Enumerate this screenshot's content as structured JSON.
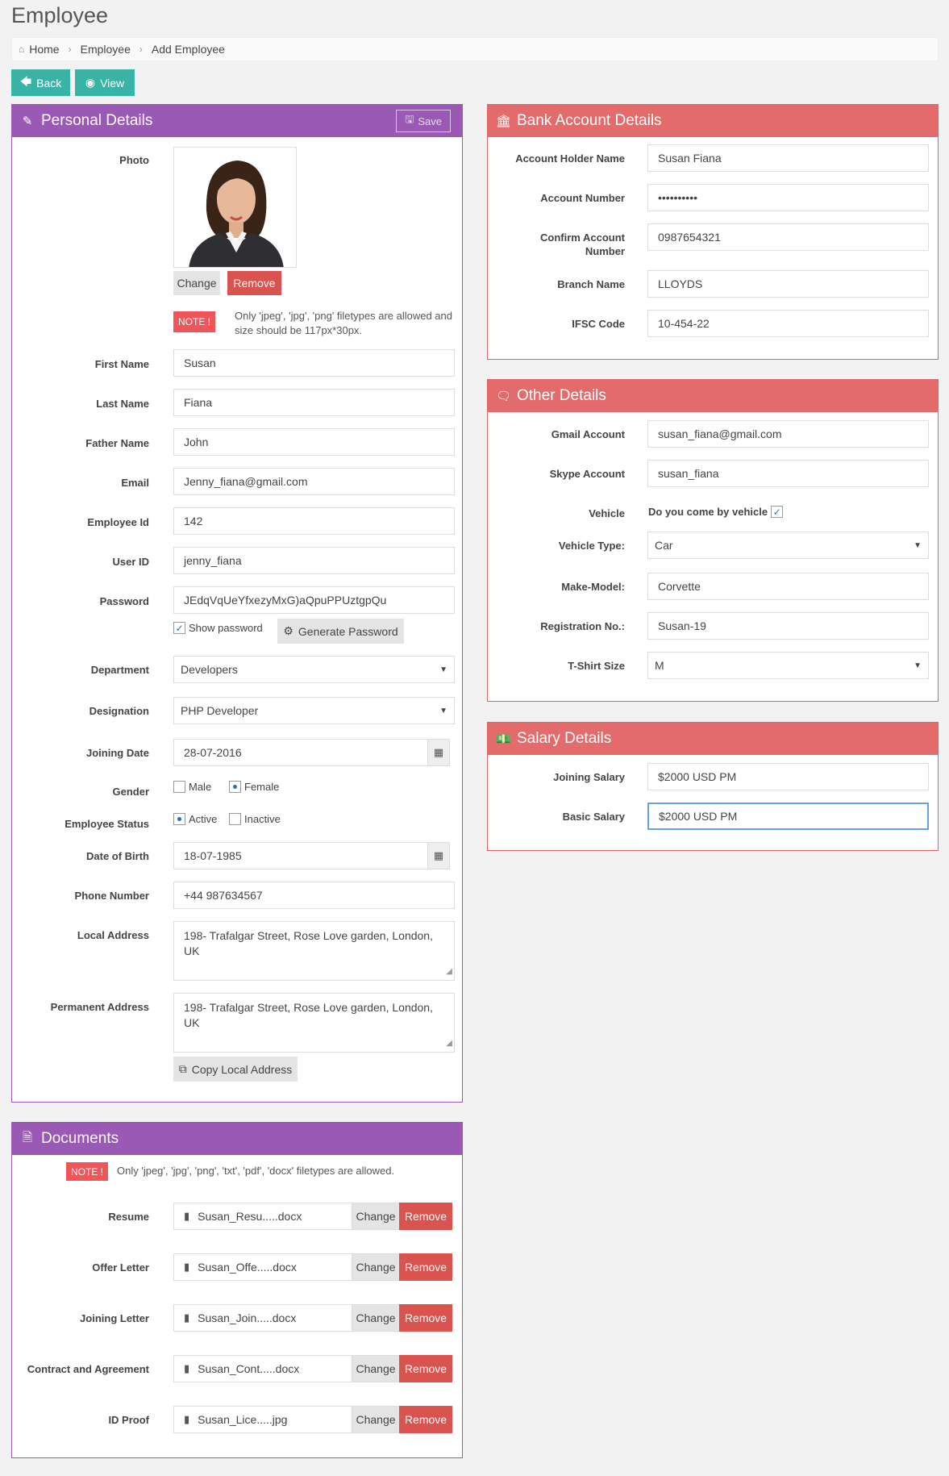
{
  "page": {
    "title": "Employee"
  },
  "breadcrumb": [
    "Home",
    "Employee",
    "Add Employee"
  ],
  "actions": {
    "back": "Back",
    "view": "View"
  },
  "personal": {
    "title": "Personal Details",
    "save": "Save",
    "photo_label": "Photo",
    "change": "Change",
    "remove": "Remove",
    "note_badge": "NOTE !",
    "note_text": "Only 'jpeg', 'jpg', 'png' filetypes are allowed and size should be 117px*30px.",
    "fields": {
      "first_name": {
        "label": "First Name",
        "value": "Susan"
      },
      "last_name": {
        "label": "Last Name",
        "value": "Fiana"
      },
      "father_name": {
        "label": "Father Name",
        "value": "John"
      },
      "email": {
        "label": "Email",
        "value": "Jenny_fiana@gmail.com"
      },
      "employee_id": {
        "label": "Employee Id",
        "value": "142"
      },
      "user_id": {
        "label": "User ID",
        "value": "jenny_fiana"
      },
      "password": {
        "label": "Password",
        "value": "JEdqVqUeYfxezyMxG)aQpuPPUztgpQu"
      },
      "department": {
        "label": "Department",
        "value": "Developers"
      },
      "designation": {
        "label": "Designation",
        "value": "PHP Developer"
      },
      "joining_date": {
        "label": "Joining Date",
        "value": "28-07-2016"
      },
      "gender": {
        "label": "Gender",
        "options": [
          "Male",
          "Female"
        ],
        "selected": "Female"
      },
      "status": {
        "label": "Employee Status",
        "options": [
          "Active",
          "Inactive"
        ],
        "selected": "Active"
      },
      "dob": {
        "label": "Date of Birth",
        "value": "18-07-1985"
      },
      "phone": {
        "label": "Phone Number",
        "value": "+44 987634567"
      },
      "local_address": {
        "label": "Local Address",
        "value": "198- Trafalgar Street, Rose Love garden, London, UK"
      },
      "permanent_address": {
        "label": "Permanent Address",
        "value": "198- Trafalgar Street, Rose Love garden, London, UK"
      }
    },
    "show_password": "Show password",
    "generate_password": "Generate Password",
    "copy_address": "Copy Local Address"
  },
  "documents": {
    "title": "Documents",
    "note_badge": "NOTE !",
    "note_text": "Only 'jpeg', 'jpg', 'png', 'txt', 'pdf', 'docx' filetypes are allowed.",
    "change": "Change",
    "remove": "Remove",
    "items": [
      {
        "label": "Resume",
        "file": "Susan_Resu.....docx"
      },
      {
        "label": "Offer Letter",
        "file": "Susan_Offe.....docx"
      },
      {
        "label": "Joining Letter",
        "file": "Susan_Join.....docx"
      },
      {
        "label": "Contract and Agreement",
        "file": "Susan_Cont.....docx"
      },
      {
        "label": "ID Proof",
        "file": "Susan_Lice.....jpg"
      }
    ]
  },
  "bank": {
    "title": "Bank Account Details",
    "holder": {
      "label": "Account Holder Name",
      "value": "Susan Fiana"
    },
    "number": {
      "label": "Account Number",
      "value": "••••••••••"
    },
    "confirm": {
      "label": "Confirm Account Number",
      "value": "0987654321"
    },
    "branch": {
      "label": "Branch Name",
      "value": "LLOYDS"
    },
    "ifsc": {
      "label": "IFSC Code",
      "value": "10-454-22"
    }
  },
  "other": {
    "title": "Other Details",
    "gmail": {
      "label": "Gmail Account",
      "value": "susan_fiana@gmail.com"
    },
    "skype": {
      "label": "Skype Account",
      "value": "susan_fiana"
    },
    "vehicle": {
      "label": "Vehicle",
      "text": "Do you come by vehicle",
      "checked": true
    },
    "vehicle_type": {
      "label": "Vehicle Type:",
      "value": "Car"
    },
    "make_model": {
      "label": "Make-Model:",
      "value": "Corvette"
    },
    "registration": {
      "label": "Registration No.:",
      "value": "Susan-19"
    },
    "tshirt": {
      "label": "T-Shirt Size",
      "value": "M"
    }
  },
  "salary": {
    "title": "Salary Details",
    "joining": {
      "label": "Joining Salary",
      "value": "$2000 USD PM"
    },
    "basic": {
      "label": "Basic Salary",
      "value": "$2000 USD PM"
    }
  },
  "colors": {
    "purple": "#9b59b6",
    "red": "#e36b6b",
    "teal": "#39b3a6",
    "danger": "#d9534f"
  }
}
